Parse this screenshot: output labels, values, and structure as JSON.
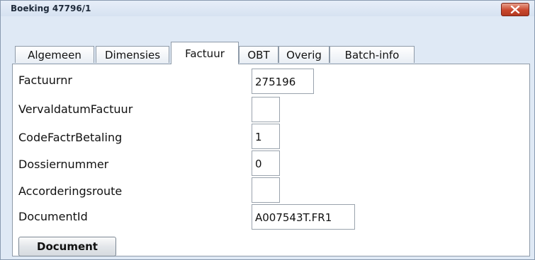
{
  "window": {
    "title": "Boeking 47796/1"
  },
  "tabs": [
    {
      "label": "Algemeen",
      "active": false
    },
    {
      "label": "Dimensies",
      "active": false
    },
    {
      "label": "Factuur",
      "active": true
    },
    {
      "label": "OBT",
      "active": false
    },
    {
      "label": "Overig",
      "active": false
    },
    {
      "label": "Batch-info",
      "active": false
    }
  ],
  "form": {
    "fields": [
      {
        "label": "Factuurnr",
        "value": "275196"
      },
      {
        "label": "VervaldatumFactuur",
        "value": ""
      },
      {
        "label": "CodeFactrBetaling",
        "value": "1"
      },
      {
        "label": "Dossiernummer",
        "value": "0"
      },
      {
        "label": "Accorderingsroute",
        "value": ""
      },
      {
        "label": "DocumentId",
        "value": "A007543T.FR1"
      }
    ],
    "document_button": "Document"
  },
  "colors": {
    "close_button": "#c9472d",
    "window_background": "#dfe9f5"
  }
}
